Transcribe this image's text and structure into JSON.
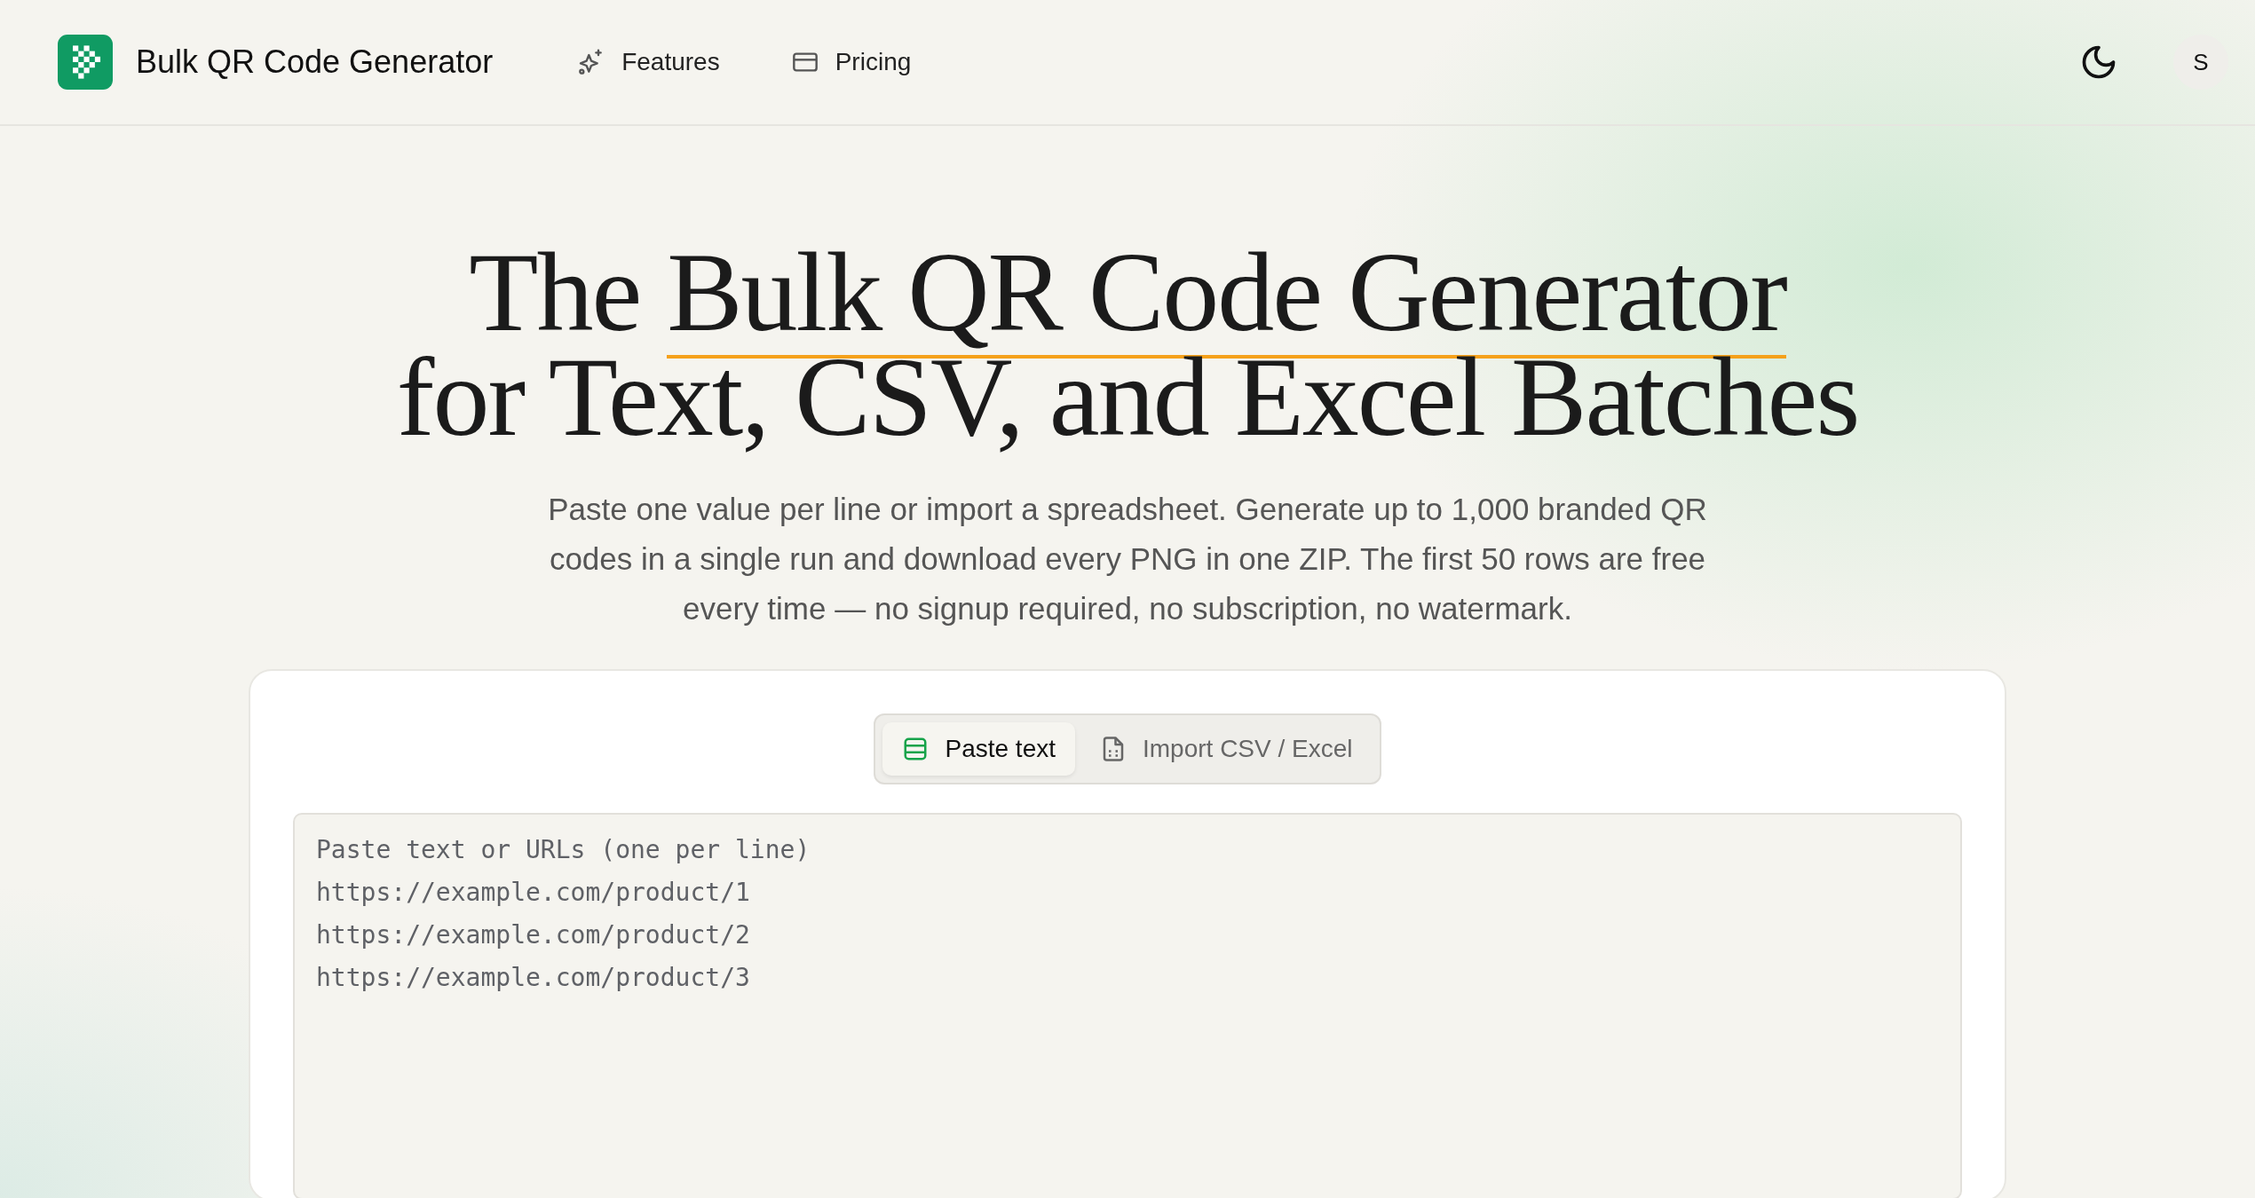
{
  "header": {
    "brand": "Bulk QR Code Generator",
    "nav": [
      {
        "label": "Features",
        "kind": "sparkle"
      },
      {
        "label": "Pricing",
        "kind": "card"
      }
    ],
    "avatar": "S"
  },
  "hero": {
    "title_prefix": "The",
    "title_highlight": "Bulk QR Code Generator",
    "title_rest": "for Text, CSV, and Excel Batches",
    "subtitle": "Paste one value per line or import a spreadsheet. Generate up to 1,000 branded QR codes in a single run and download every PNG in one ZIP. The first 50 rows are free every time — no signup required, no subscription, no watermark."
  },
  "input_panel": {
    "tabs": [
      {
        "label": "Paste text",
        "kind": "table",
        "selected": true
      },
      {
        "label": "Import CSV / Excel",
        "kind": "file",
        "selected": false
      }
    ],
    "textarea": {
      "placeholder": "Paste text or URLs (one per line)\nhttps://example.com/product/1\nhttps://example.com/product/2\nhttps://example.com/product/3"
    }
  }
}
